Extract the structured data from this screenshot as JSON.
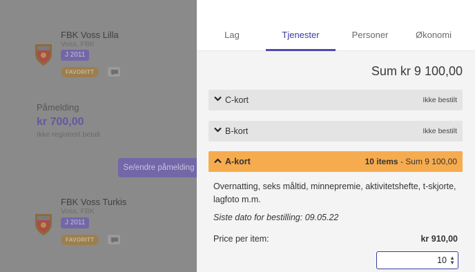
{
  "background": {
    "teams": [
      {
        "name": "FBK Voss Lilla",
        "club": "Voss, FBK",
        "age_group": "J 2011",
        "favorite": "FAVORITT"
      },
      {
        "name": "FBK Voss Turkis",
        "club": "Voss, FBK",
        "age_group": "J 2011",
        "favorite": "FAVORITT"
      }
    ],
    "registration": {
      "title": "Påmelding",
      "amount": "kr 700,00",
      "status": "Ikke registrert betalt",
      "button": "Se/endre påmelding"
    }
  },
  "panel": {
    "tabs": [
      {
        "label": "Lag",
        "active": false
      },
      {
        "label": "Tjenester",
        "active": true
      },
      {
        "label": "Personer",
        "active": false
      },
      {
        "label": "Økonomi",
        "active": false
      }
    ],
    "sum": "Sum kr 9 100,00",
    "services": [
      {
        "title": "C-kort",
        "status": "Ikke bestilt",
        "expanded": false
      },
      {
        "title": "B-kort",
        "status": "Ikke bestilt",
        "expanded": false
      },
      {
        "title": "A-kort",
        "expanded": true,
        "items_label": "10 items",
        "sum_label": "- Sum  9 100,00",
        "description": "Overnatting, seks måltid, minnepremie, aktivitetshefte, t-skjorte, lagfoto m.m.",
        "deadline": "Siste dato for bestilling: 09.05.22",
        "price_label": "Price per item:",
        "price_value": "kr 910,00",
        "quantity": "10"
      }
    ]
  },
  "colors": {
    "accent": "#3a3aa6",
    "expanded_header": "#f6ac4e",
    "collapsed_header": "#e4e4e4",
    "overlay": "#8a8a8a"
  },
  "icons": {
    "team_logo": "club-crest-icon",
    "chat": "chat-bubble-icon",
    "collapsed": "chevron-down-icon",
    "expanded": "chevron-up-icon"
  }
}
